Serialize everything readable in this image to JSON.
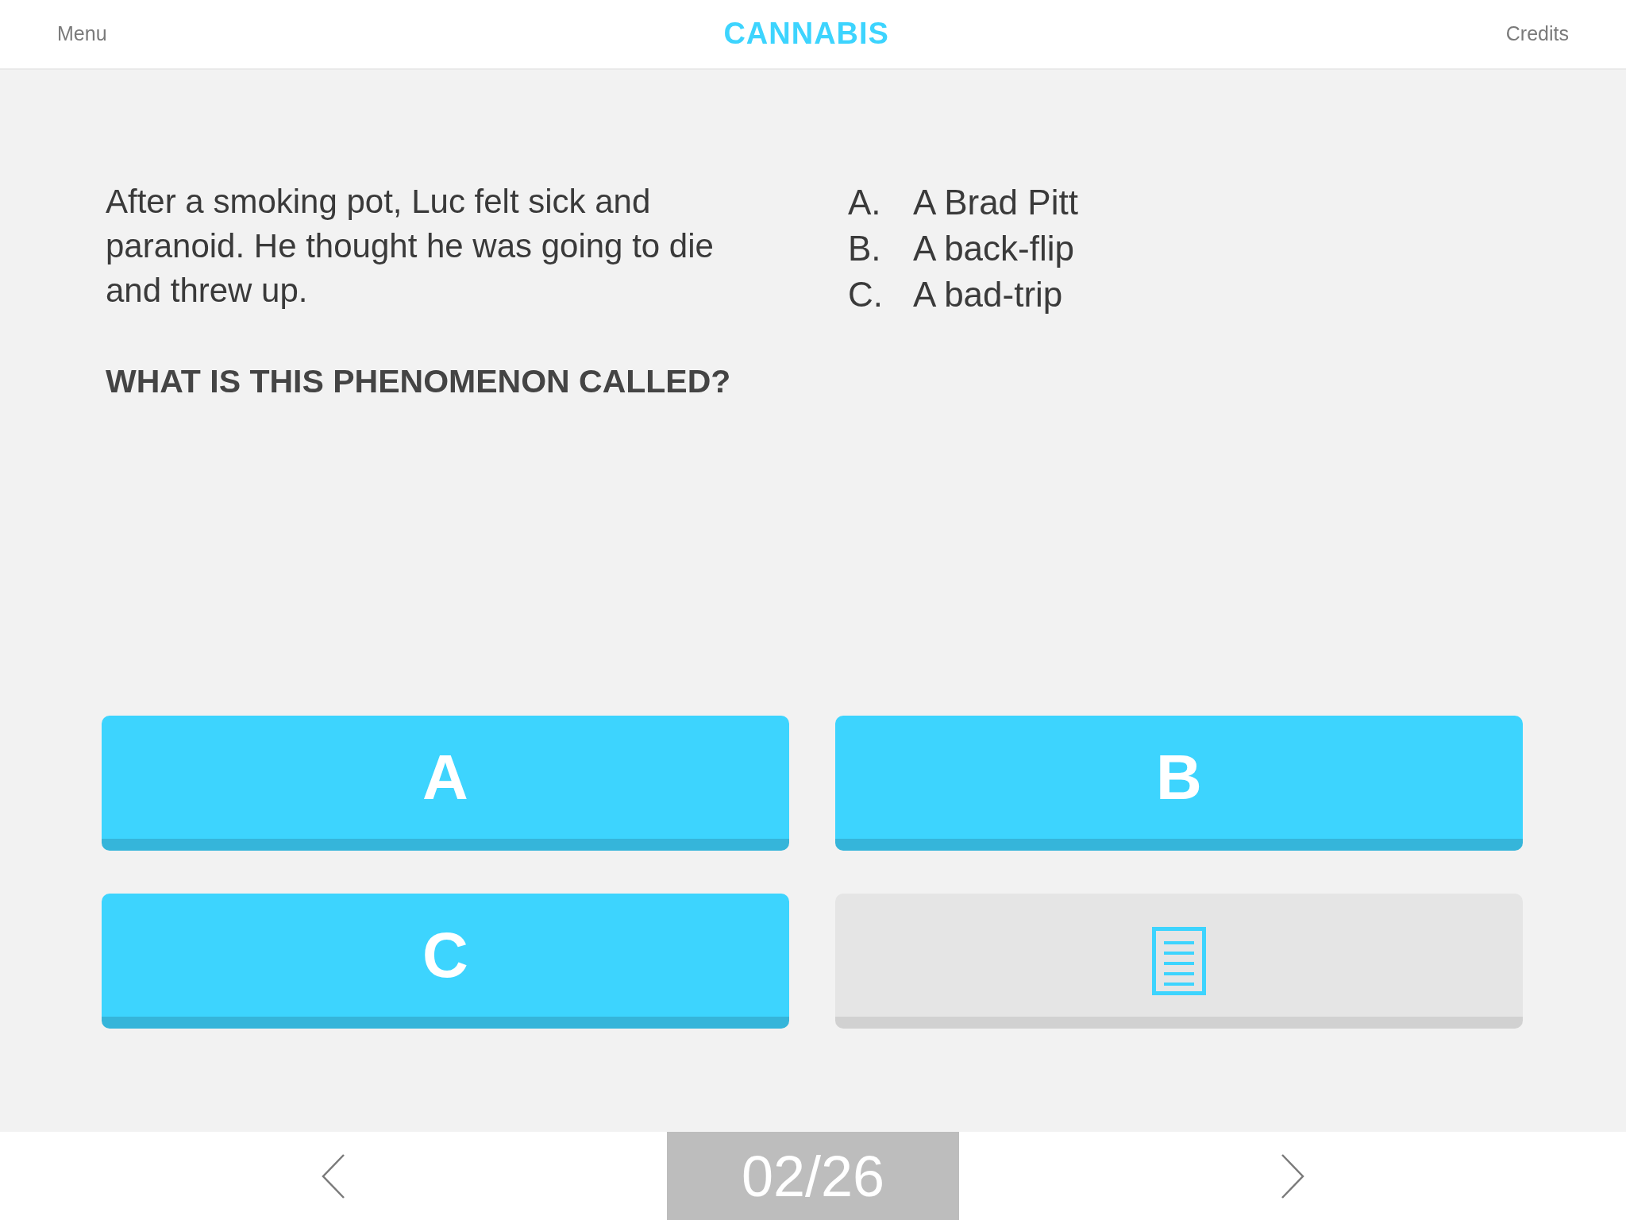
{
  "header": {
    "menu": "Menu",
    "title": "CANNABIS",
    "credits": "Credits"
  },
  "question": {
    "text": "After a smoking pot, Luc felt sick and paranoid. He thought he was going to die and threw up.",
    "prompt": "WHAT IS THIS PHENOMENON CALLED?"
  },
  "options": [
    {
      "letter": "A.",
      "text": "A Brad Pitt"
    },
    {
      "letter": "B.",
      "text": "A back-flip"
    },
    {
      "letter": "C.",
      "text": "A bad-trip"
    }
  ],
  "answer_buttons": [
    {
      "kind": "letter",
      "label": "A"
    },
    {
      "kind": "letter",
      "label": "B"
    },
    {
      "kind": "letter",
      "label": "C"
    },
    {
      "kind": "notes"
    }
  ],
  "footer": {
    "counter": "02/26"
  }
}
